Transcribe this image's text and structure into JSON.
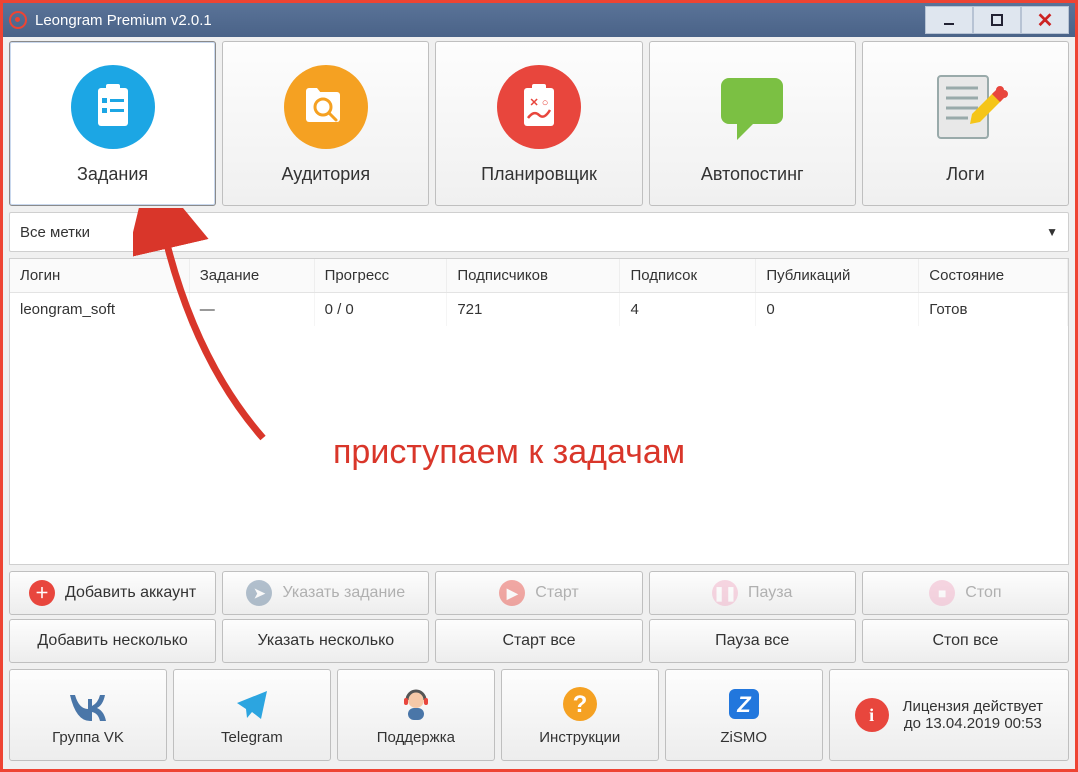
{
  "window": {
    "title": "Leongram Premium v2.0.1"
  },
  "tabs": [
    {
      "label": "Задания"
    },
    {
      "label": "Аудитория"
    },
    {
      "label": "Планировщик"
    },
    {
      "label": "Автопостинг"
    },
    {
      "label": "Логи"
    }
  ],
  "filter": {
    "selected": "Все метки"
  },
  "columns": {
    "login": "Логин",
    "task": "Задание",
    "progress": "Прогресс",
    "subscribers": "Подписчиков",
    "subscriptions": "Подписок",
    "publications": "Публикаций",
    "state": "Состояние"
  },
  "rows": [
    {
      "login": "leongram_soft",
      "task": "—",
      "progress": "0 / 0",
      "subscribers": "721",
      "subscriptions": "4",
      "publications": "0",
      "state": "Готов"
    }
  ],
  "annotation": "приступаем к задачам",
  "actions": {
    "add_account": "Добавить аккаунт",
    "set_task": "Указать задание",
    "start": "Старт",
    "pause": "Пауза",
    "stop": "Стоп",
    "add_multiple": "Добавить несколько",
    "set_multiple": "Указать несколько",
    "start_all": "Старт все",
    "pause_all": "Пауза все",
    "stop_all": "Стоп все"
  },
  "footer": {
    "vk": "Группа VK",
    "telegram": "Telegram",
    "support": "Поддержка",
    "instructions": "Инструкции",
    "zismo": "ZiSMO"
  },
  "license": {
    "line1": "Лицензия действует",
    "line2": "до 13.04.2019 00:53"
  }
}
